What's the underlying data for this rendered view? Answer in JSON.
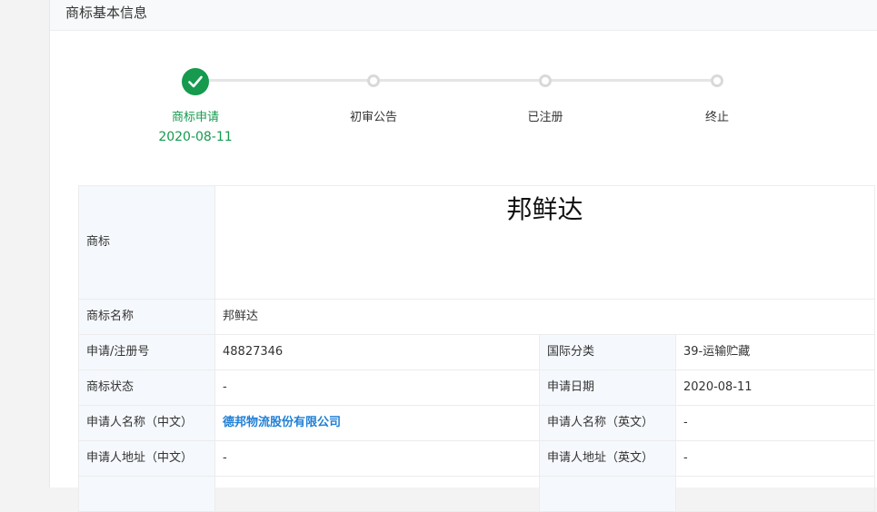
{
  "section": {
    "title": "商标基本信息"
  },
  "steps": [
    {
      "label": "商标申请",
      "date": "2020-08-11",
      "status": "done"
    },
    {
      "label": "初审公告",
      "date": "",
      "status": "pending"
    },
    {
      "label": "已注册",
      "date": "",
      "status": "pending"
    },
    {
      "label": "终止",
      "date": "",
      "status": "pending"
    }
  ],
  "colors": {
    "accent_green": "#159a4e",
    "link_blue": "#1f7fd6",
    "label_bg": "#f5f8fc"
  },
  "table": {
    "trademark_label": "商标",
    "trademark_image_text": "邦鲜达",
    "name_label": "商标名称",
    "name_value": "邦鲜达",
    "reg_no_label": "申请/注册号",
    "reg_no_value": "48827346",
    "intl_class_label": "国际分类",
    "intl_class_value": "39-运输贮藏",
    "status_label": "商标状态",
    "status_value": "-",
    "apply_date_label": "申请日期",
    "apply_date_value": "2020-08-11",
    "applicant_cn_label": "申请人名称（中文）",
    "applicant_cn_value": "德邦物流股份有限公司",
    "applicant_en_label": "申请人名称（英文）",
    "applicant_en_value": "-",
    "address_cn_label": "申请人地址（中文）",
    "address_cn_value": "-",
    "address_en_label": "申请人地址（英文）",
    "address_en_value": "-"
  }
}
